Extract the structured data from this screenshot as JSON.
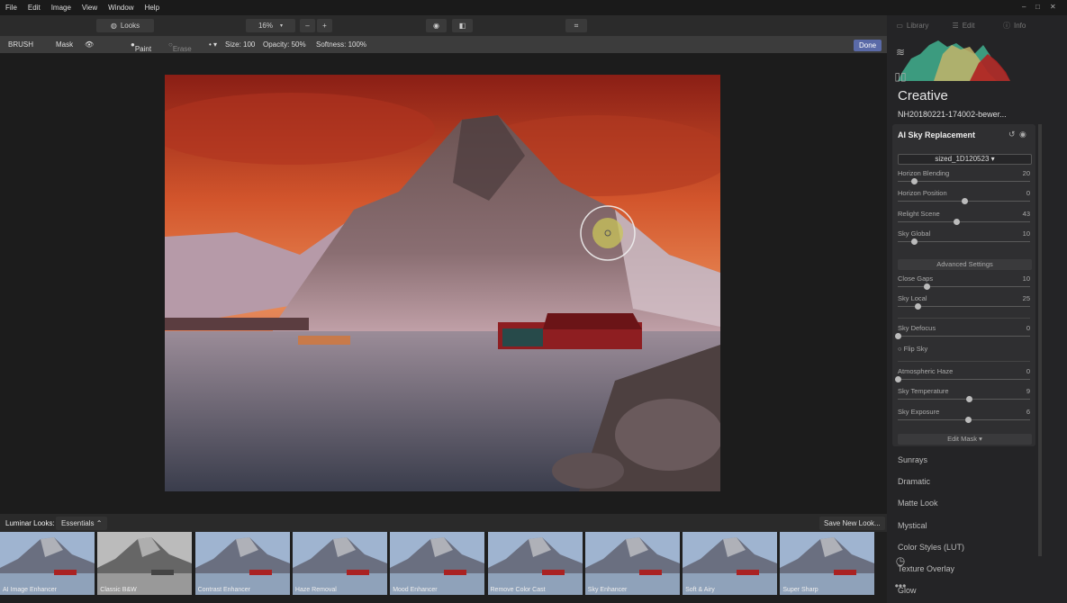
{
  "menu": [
    "File",
    "Edit",
    "Image",
    "View",
    "Window",
    "Help"
  ],
  "toolbar": {
    "looks_label": "Looks",
    "zoom": "16%",
    "minus": "–",
    "plus": "+"
  },
  "brushbar": {
    "brush": "BRUSH",
    "mask": "Mask",
    "paint": "Paint",
    "erase": "Erase",
    "size": "Size: 100",
    "opacity": "Opacity: 50%",
    "softness": "Softness: 100%",
    "done": "Done"
  },
  "tabs": [
    "Library",
    "Edit",
    "Info"
  ],
  "panel": {
    "title": "Creative",
    "filename": "NH20180221-174002-bewer...",
    "tool_title": "AI Sky Replacement",
    "sky_select": "sized_1D120523",
    "sliders1": [
      {
        "label": "Horizon Blending",
        "value": "20",
        "pos": 0.12
      },
      {
        "label": "Horizon Position",
        "value": "0",
        "pos": 0.5
      },
      {
        "label": "Relight Scene",
        "value": "43",
        "pos": 0.44
      },
      {
        "label": "Sky Global",
        "value": "10",
        "pos": 0.12
      }
    ],
    "advanced": "Advanced Settings",
    "sliders2": [
      {
        "label": "Close Gaps",
        "value": "10",
        "pos": 0.22
      },
      {
        "label": "Sky Local",
        "value": "25",
        "pos": 0.15
      }
    ],
    "sliders3": [
      {
        "label": "Sky Defocus",
        "value": "0",
        "pos": 0.0
      }
    ],
    "flip": "Flip Sky",
    "sliders4": [
      {
        "label": "Atmospheric Haze",
        "value": "0",
        "pos": 0.0
      },
      {
        "label": "Sky Temperature",
        "value": "9",
        "pos": 0.54
      },
      {
        "label": "Sky Exposure",
        "value": "6",
        "pos": 0.53
      }
    ],
    "edit_mask": "Edit Mask"
  },
  "looks": [
    "Sunrays",
    "Dramatic",
    "Matte Look",
    "Mystical",
    "Color Styles (LUT)",
    "Texture Overlay",
    "Glow"
  ],
  "bottom": {
    "label": "Luminar Looks:",
    "category": "Essentials",
    "save": "Save New Look..."
  },
  "thumbs": [
    "AI Image Enhancer",
    "Classic B&W",
    "Contrast Enhancer",
    "Haze Removal",
    "Mood Enhancer",
    "Remove Color Cast",
    "Sky Enhancer",
    "Soft & Airy",
    "Super Sharp"
  ]
}
